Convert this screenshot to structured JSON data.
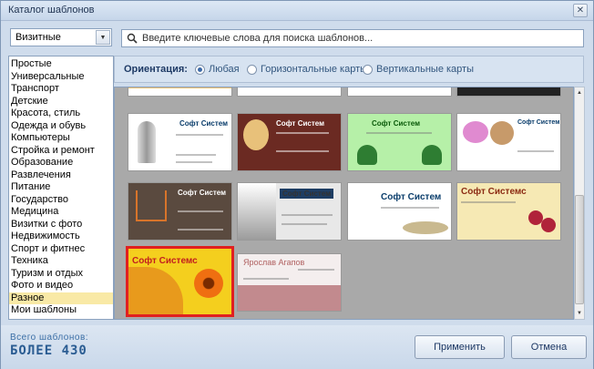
{
  "window": {
    "title": "Каталог шаблонов",
    "close_glyph": "✕"
  },
  "category_select": {
    "value": "Визитные"
  },
  "categories": [
    "Простые",
    "Универсальные",
    "Транспорт",
    "Детские",
    "Красота, стиль",
    "Одежда и обувь",
    "Компьютеры",
    "Стройка и ремонт",
    "Образование",
    "Развлечения",
    "Питание",
    "Государство",
    "Медицина",
    "Визитки с фото",
    "Недвижимость",
    "Спорт и фитнес",
    "Техника",
    "Туризм и отдых",
    "Фото и видео",
    "Разное",
    "Мои шаблоны"
  ],
  "selected_category": "Разное",
  "search": {
    "placeholder": "Введите ключевые слова для поиска шаблонов...",
    "icon": "search-icon"
  },
  "orientation": {
    "label": "Ориентация:",
    "options": [
      "Любая",
      "Горизонтальные карты",
      "Вертикальные карты"
    ],
    "selected": "Любая"
  },
  "templates": [
    {
      "company": "Софт Систем",
      "bg": "#ffffff",
      "fg": "#0a3d6b"
    },
    {
      "company": "Софт Систем",
      "bg": "#6b2a22",
      "fg": "#ffffff"
    },
    {
      "company": "Софт Систем",
      "bg": "#b6f0a8",
      "fg": "#0a5a0a"
    },
    {
      "company": "Софт Систем",
      "bg": "#ffffff",
      "fg": "#0a3d6b"
    },
    {
      "company": "Софт Систем",
      "bg": "#5a4a3f",
      "fg": "#ffffff"
    },
    {
      "company": "Софт Систем",
      "bg": "#e8e8e8",
      "fg": "#333333"
    },
    {
      "company": "Софт Систем",
      "bg": "#ffffff",
      "fg": "#0a3d6b"
    },
    {
      "company": "Софт Системс",
      "bg": "#f6e9b4",
      "fg": "#8b2a12"
    },
    {
      "company": "Софт Системс",
      "bg": "#f4cf1e",
      "fg": "#c21e1e"
    },
    {
      "company": "Ярослав Агапов",
      "bg": "#f4eeee",
      "fg": "#b06060"
    }
  ],
  "total": {
    "label": "Всего шаблонов:",
    "value": "БОЛЕЕ 430"
  },
  "buttons": {
    "apply": "Применить",
    "cancel": "Отмена"
  }
}
